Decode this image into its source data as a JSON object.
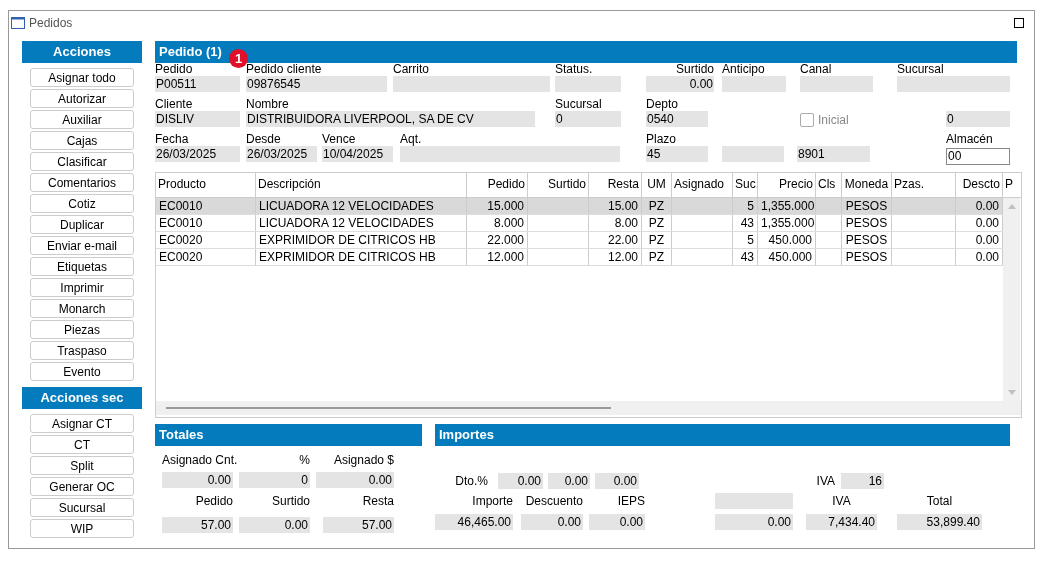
{
  "window": {
    "title": "Pedidos"
  },
  "acciones": {
    "title": "Acciones",
    "buttons": [
      "Asignar todo",
      "Autorizar",
      "Auxiliar",
      "Cajas",
      "Clasificar",
      "Comentarios",
      "Cotiz",
      "Duplicar",
      "Enviar e-mail",
      "Etiquetas",
      "Imprimir",
      "Monarch",
      "Piezas",
      "Traspaso",
      "Evento"
    ]
  },
  "acciones_sec": {
    "title": "Acciones sec",
    "buttons": [
      "Asignar CT",
      "CT",
      "Split",
      "Generar OC",
      "Sucursal",
      "WIP"
    ]
  },
  "pedido": {
    "title": "Pedido (1)",
    "badge": "1",
    "rows": [
      [
        {
          "kind": "field",
          "label": "Pedido",
          "value": "P00511"
        },
        {
          "kind": "field",
          "label": "Pedido cliente",
          "value": "09876545"
        },
        {
          "kind": "field",
          "label": "Carrito"
        },
        {
          "kind": "field",
          "label": "Status."
        },
        {
          "kind": "field",
          "label": "Surtido",
          "value": "0.00"
        },
        {
          "kind": "field",
          "label": "Anticipo"
        },
        {
          "kind": "field",
          "label": "Canal"
        },
        {
          "kind": "field",
          "label": "Sucursal"
        }
      ],
      [
        {
          "kind": "field",
          "label": "Cliente",
          "value": "DISLIV"
        },
        {
          "kind": "field",
          "label": "Nombre",
          "value": "DISTRIBUIDORA LIVERPOOL, SA DE CV"
        },
        {
          "kind": "field",
          "label": "Sucursal",
          "value": "0"
        },
        {
          "kind": "field",
          "label": "Depto",
          "value": "0540"
        },
        {
          "kind": "checkbox",
          "label": "Inicial",
          "checked": false,
          "disabled": true
        },
        {
          "kind": "field",
          "value": "0"
        }
      ],
      [
        {
          "kind": "field",
          "label": "Fecha",
          "value": "26/03/2025"
        },
        {
          "kind": "field",
          "label": "Desde",
          "value": "26/03/2025"
        },
        {
          "kind": "field",
          "label": "Vence",
          "value": "10/04/2025"
        },
        {
          "kind": "field",
          "label": "Aqt."
        },
        {
          "kind": "field",
          "label": "Plazo",
          "value": "45"
        },
        {
          "kind": "field"
        },
        {
          "kind": "field",
          "value": "8901"
        },
        {
          "kind": "input",
          "label": "Almacén",
          "value": "00"
        }
      ]
    ]
  },
  "table": {
    "columns": [
      "Producto",
      "Descripción",
      "Pedido",
      "Surtido",
      "Resta",
      "UM",
      "Asignado",
      "Suc.",
      "Precio",
      "Cls",
      "Moneda",
      "Pzas.",
      "Descto",
      "P"
    ],
    "rows": [
      {
        "selected": true,
        "cells": [
          "EC0010",
          "LICUADORA 12 VELOCIDADES",
          "15.000",
          "",
          "15.00",
          "PZ",
          "",
          "5",
          "1,355.000",
          "",
          "PESOS",
          "",
          "0.00"
        ]
      },
      {
        "selected": false,
        "cells": [
          "EC0010",
          "LICUADORA 12 VELOCIDADES",
          "8.000",
          "",
          "8.00",
          "PZ",
          "",
          "43",
          "1,355.000",
          "",
          "PESOS",
          "",
          "0.00"
        ]
      },
      {
        "selected": false,
        "cells": [
          "EC0020",
          "EXPRIMIDOR DE CITRICOS HB",
          "22.000",
          "",
          "22.00",
          "PZ",
          "",
          "5",
          "450.000",
          "",
          "PESOS",
          "",
          "0.00"
        ]
      },
      {
        "selected": false,
        "cells": [
          "EC0020",
          "EXPRIMIDOR DE CITRICOS HB",
          "12.000",
          "",
          "12.00",
          "PZ",
          "",
          "43",
          "450.000",
          "",
          "PESOS",
          "",
          "0.00"
        ]
      }
    ]
  },
  "totales": {
    "title": "Totales",
    "lines": [
      [
        {
          "kind": "label",
          "text": "Asignado Cnt."
        },
        {
          "kind": "label",
          "text": "%"
        },
        {
          "kind": "label",
          "text": "Asignado $"
        }
      ],
      [
        {
          "kind": "field",
          "text": "0.00"
        },
        {
          "kind": "field",
          "text": "0"
        },
        {
          "kind": "field",
          "text": "0.00"
        }
      ],
      [
        {
          "kind": "label",
          "text": "Pedido"
        },
        {
          "kind": "label",
          "text": "Surtido"
        },
        {
          "kind": "label",
          "text": "Resta"
        }
      ],
      [
        {
          "kind": "field",
          "text": "57.00"
        },
        {
          "kind": "field",
          "text": "0.00"
        },
        {
          "kind": "field",
          "text": "57.00"
        }
      ]
    ]
  },
  "importes": {
    "title": "Importes",
    "lines": [
      [
        {
          "kind": "label",
          "text": "Dto.%"
        },
        {
          "kind": "field",
          "text": "0.00"
        },
        {
          "kind": "field",
          "text": "0.00"
        },
        {
          "kind": "field",
          "text": "0.00"
        },
        {
          "kind": "label",
          "text": "IVA"
        },
        {
          "kind": "field",
          "text": "16"
        }
      ],
      [
        {
          "kind": "label",
          "text": "Importe"
        },
        {
          "kind": "label",
          "text": "Descuento"
        },
        {
          "kind": "label",
          "text": "IEPS"
        },
        {
          "kind": "field"
        },
        {
          "kind": "label",
          "text": "IVA"
        },
        {
          "kind": "label",
          "text": "Total"
        }
      ],
      [
        {
          "kind": "field",
          "text": "46,465.00"
        },
        {
          "kind": "field",
          "text": "0.00"
        },
        {
          "kind": "field",
          "text": "0.00"
        },
        {
          "kind": "field",
          "text": "0.00"
        },
        {
          "kind": "field",
          "text": "7,434.40"
        },
        {
          "kind": "field",
          "text": "53,899.40"
        }
      ]
    ]
  }
}
